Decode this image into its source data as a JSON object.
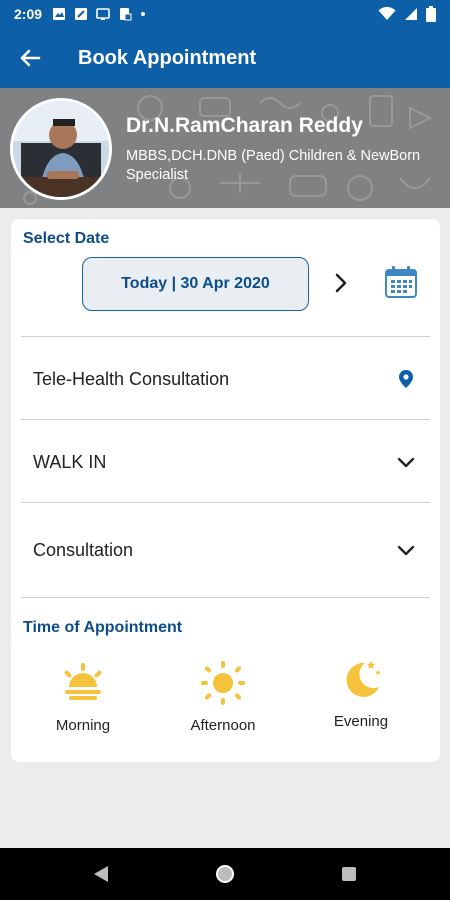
{
  "status_bar": {
    "time": "2:09"
  },
  "app_bar": {
    "title": "Book Appointment"
  },
  "doctor": {
    "name": "Dr.N.RamCharan Reddy",
    "qualification": "MBBS,DCH.DNB (Paed) Children & NewBorn Specialist"
  },
  "select_date": {
    "label": "Select Date",
    "value": "Today | 30 Apr 2020"
  },
  "rows": [
    {
      "label": "Tele-Health Consultation",
      "icon": "location-pin-icon"
    },
    {
      "label": "WALK IN",
      "icon": "chevron-down-icon"
    },
    {
      "label": "Consultation",
      "icon": "chevron-down-icon"
    }
  ],
  "time_of_appointment": {
    "label": "Time of Appointment",
    "slots": [
      {
        "label": "Morning",
        "icon": "sunrise-icon"
      },
      {
        "label": "Afternoon",
        "icon": "sun-icon"
      },
      {
        "label": "Evening",
        "icon": "moon-icon"
      }
    ]
  },
  "colors": {
    "primary": "#0d5fa8",
    "heading": "#0d4e8a",
    "sun": "#f5c33b"
  }
}
